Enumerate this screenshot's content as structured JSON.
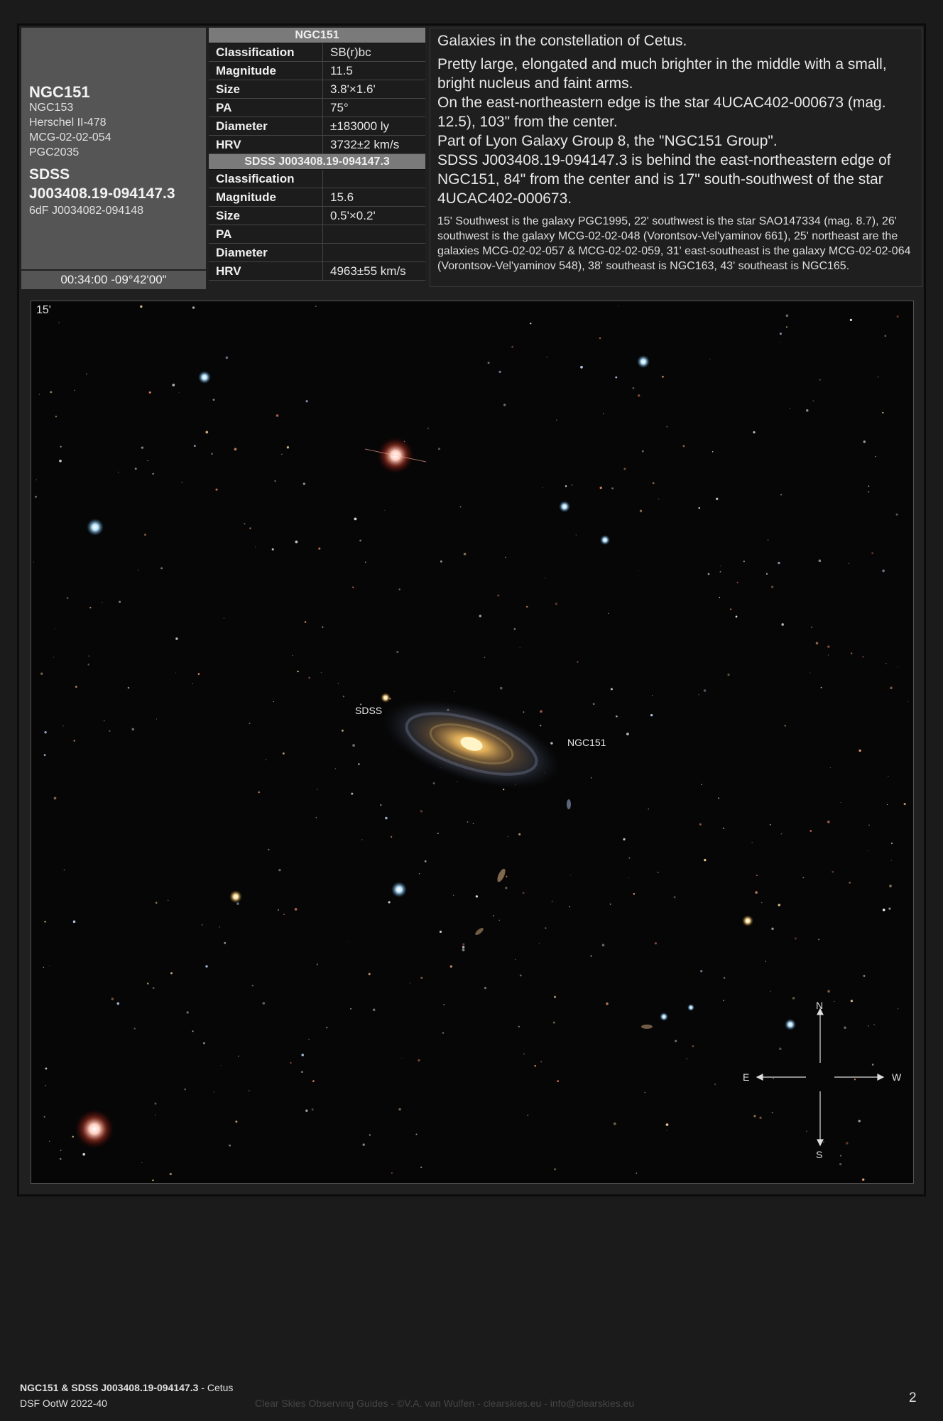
{
  "names": {
    "primary": "NGC151",
    "aliases": [
      "NGC153",
      "Herschel II-478",
      "MCG-02-02-054",
      "PGC2035"
    ],
    "secondary_line1": "SDSS",
    "secondary_line2": "J003408.19-094147.3",
    "secondary_alias": "6dF J0034082-094148",
    "coordinates": "00:34:00 -09°42'00\""
  },
  "table1": {
    "title": "NGC151",
    "rows": [
      {
        "k": "Classification",
        "v": "SB(r)bc"
      },
      {
        "k": "Magnitude",
        "v": "11.5"
      },
      {
        "k": "Size",
        "v": "3.8'×1.6'"
      },
      {
        "k": "PA",
        "v": "75°"
      },
      {
        "k": "Diameter",
        "v": "±183000 ly"
      },
      {
        "k": "HRV",
        "v": "3732±2 km/s"
      }
    ]
  },
  "table2": {
    "title": "SDSS J003408.19-094147.3",
    "rows": [
      {
        "k": "Classification",
        "v": ""
      },
      {
        "k": "Magnitude",
        "v": "15.6"
      },
      {
        "k": "Size",
        "v": "0.5'×0.2'"
      },
      {
        "k": "PA",
        "v": ""
      },
      {
        "k": "Diameter",
        "v": ""
      },
      {
        "k": "HRV",
        "v": "4963±55 km/s"
      }
    ]
  },
  "description": {
    "p1": "Galaxies in the constellation of Cetus.",
    "p2": "Pretty large, elongated and much brighter in the middle with a small, bright nucleus and faint arms.",
    "p3": "On the east-northeastern edge is the star 4UCAC402-000673 (mag. 12.5), 103\" from the center.",
    "p4": "Part of Lyon Galaxy Group 8, the \"NGC151 Group\".",
    "p5": "SDSS J003408.19-094147.3 is behind the east-northeastern edge of NGC151, 84\" from the center and is 17\" south-southwest of the star 4UCAC402-000673.",
    "p6": "15' Southwest is the galaxy PGC1995, 22' southwest is the star SAO147334 (mag. 8.7), 26' southwest is the galaxy MCG-02-02-048 (Vorontsov-Vel'yaminov 661), 25' northeast are the galaxies MCG-02-02-057 & MCG-02-02-059, 31' east-southeast is the galaxy MCG-02-02-064 (Vorontsov-Vel'yaminov 548), 38' southeast is NGC163, 43' southeast is NGC165."
  },
  "image": {
    "scale": "15'",
    "label_sdss": "SDSS",
    "label_ngc": "NGC151",
    "compass": {
      "n": "N",
      "s": "S",
      "e": "E",
      "w": "W"
    }
  },
  "footer": {
    "title_bold": "NGC151 & SDSS J003408.19-094147.3",
    "title_rest": " - Cetus",
    "series": "DSF OotW 2022-40",
    "credits": "Clear Skies Observing Guides - ©V.A. van Wulfen - clearskies.eu - info@clearskies.eu",
    "page": "2"
  }
}
